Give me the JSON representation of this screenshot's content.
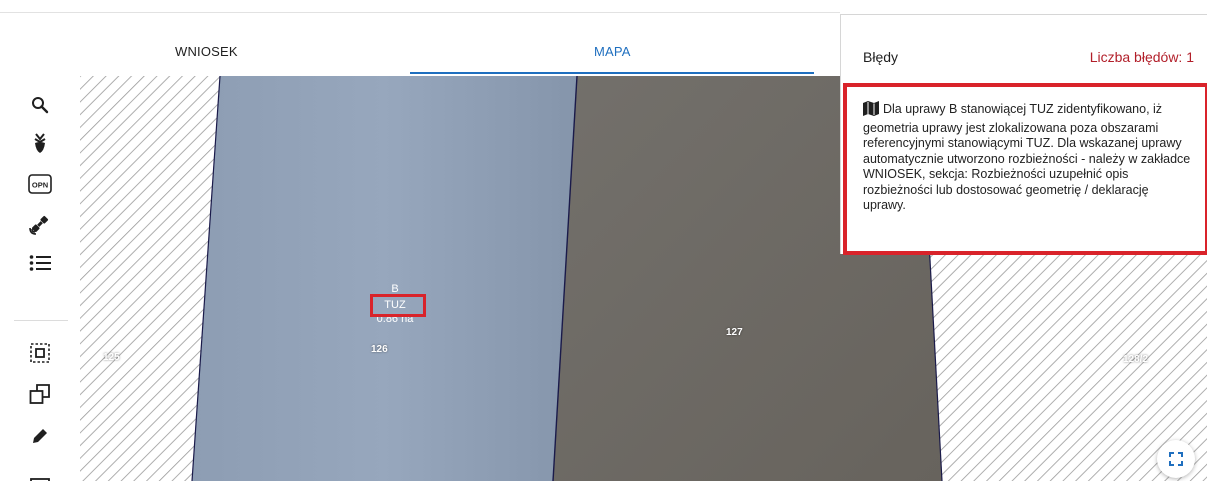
{
  "tabs": [
    {
      "label": "WNIOSEK",
      "active": false
    },
    {
      "label": "MAPA",
      "active": true
    }
  ],
  "errors_panel": {
    "title": "Błędy",
    "count_label": "Liczba błędów: 1",
    "message": "Dla uprawy B stanowiącej TUZ zidentyfikowano, iż geometria uprawy jest zlokalizowana poza obszarami referencyjnymi stanowiącymi TUZ. Dla wskazanej uprawy automatycznie utworzono rozbieżności - należy w zakładce WNIOSEK, sekcja: Rozbieżności uzupełnić opis rozbieżności lub dostosować geometrię / deklarację uprawy.",
    "icon": "map-icon"
  },
  "toolbar": {
    "items": [
      {
        "icon": "search-icon"
      },
      {
        "icon": "crop-plant-icon"
      },
      {
        "icon": "opn-icon",
        "text": "OPN"
      },
      {
        "icon": "satellite-icon"
      },
      {
        "icon": "list-icon"
      },
      {
        "icon": "select-area-icon"
      },
      {
        "icon": "copy-icon"
      },
      {
        "icon": "pencil-icon"
      }
    ]
  },
  "map": {
    "parcels": [
      "125",
      "126",
      "127",
      "128/2"
    ],
    "crop": {
      "name": "B",
      "type": "TUZ",
      "area": "0.86 ha"
    },
    "fullscreen_icon": "fullscreen-icon"
  },
  "colors": {
    "accent": "#1f6fbf",
    "error": "#d9232a",
    "error_text": "#b21f2a",
    "crop_field": "#8b9cb5",
    "bare_field": "#6f6a63"
  }
}
